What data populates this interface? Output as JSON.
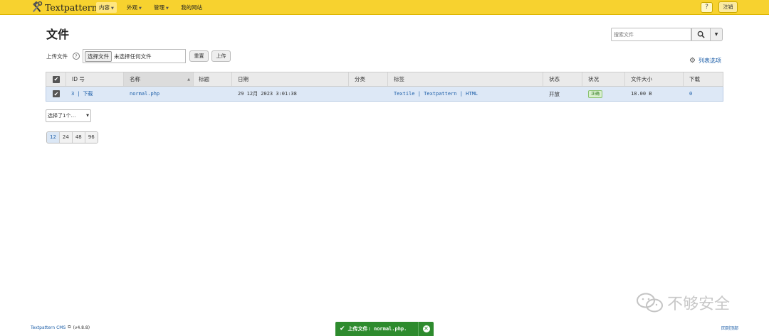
{
  "brand": {
    "name": "Textpattern",
    "icon": "hammer-wrench-icon"
  },
  "nav": {
    "content": "内容",
    "presentation": "外观",
    "admin": "管理",
    "site": "我的网站"
  },
  "header": {
    "help": "?",
    "logout": "注销"
  },
  "page_title": "文件",
  "search": {
    "placeholder": "搜索文件"
  },
  "upload": {
    "label": "上传文件",
    "help": "?",
    "choose_label": "选择文件",
    "no_file_text": "未选择任何文件",
    "reset_label": "重置",
    "upload_label": "上传"
  },
  "list_options": "列表选项",
  "table": {
    "headers": {
      "id": "ID 号",
      "name": "名称",
      "title": "标题",
      "date": "日期",
      "category": "分类",
      "tags": "标签",
      "status": "状态",
      "condition": "状况",
      "filesize": "文件大小",
      "downloads": "下载"
    },
    "rows": [
      {
        "id": "3",
        "sep": "|",
        "download": "下载",
        "name": "normal.php",
        "title": "",
        "date": "29 12月 2023 3:01:38",
        "category": "",
        "tags": "Textile | Textpattern | HTML",
        "status": "开放",
        "condition": "正确",
        "filesize": "18.00 B",
        "downloads": "0"
      }
    ]
  },
  "multi_edit": "选择了1个…",
  "pager": [
    "12",
    "24",
    "48",
    "96"
  ],
  "footer": {
    "cms_link": "Textpattern CMS",
    "version": "(v4.8.8)",
    "back_to_top": "回到顶部"
  },
  "toast": {
    "message": "上传文件: normal.php."
  },
  "watermark": "不够安全",
  "colors": {
    "topbar": "#f7d22f",
    "link": "#1c5ea8",
    "toast": "#2e8b2e",
    "selected_row": "#dde8f6"
  }
}
